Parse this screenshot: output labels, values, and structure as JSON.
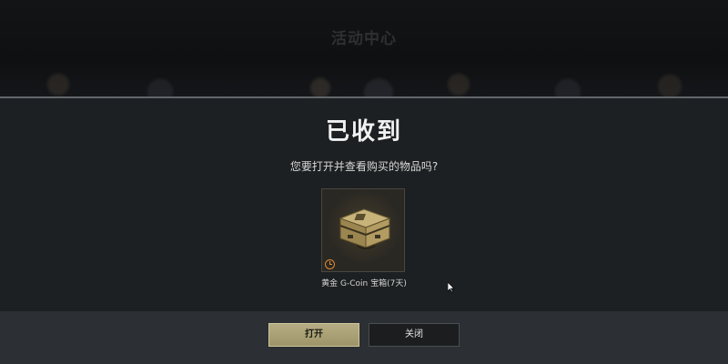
{
  "background": {
    "title": "活动中心"
  },
  "dialog": {
    "title": "已收到",
    "prompt": "您要打开并查看购买的物品吗?",
    "item": {
      "name": "黄金 G-Coin 宝箱(7天)",
      "icon": "golden-crate-icon",
      "timer_icon": "clock-icon"
    }
  },
  "buttons": {
    "open_label": "打开",
    "close_label": "关闭"
  },
  "colors": {
    "accent": "#b6ad84",
    "timer": "#e08a32",
    "dialog_bg": "#1d2022",
    "footer_bg": "#2c2f33"
  }
}
